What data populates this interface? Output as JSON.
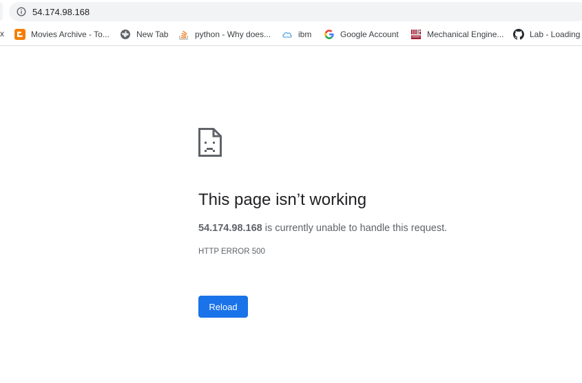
{
  "omnibox": {
    "url": "54.174.98.168",
    "info_icon": "info-circle-icon"
  },
  "bookmarks_bar": {
    "truncated_left": "x",
    "items": [
      {
        "label": "Movies Archive - To...",
        "icon": "blogger-icon",
        "color": "#f57d00"
      },
      {
        "label": "New Tab",
        "icon": "globe-icon",
        "color": "#5f6368"
      },
      {
        "label": "python - Why does...",
        "icon": "stackoverflow-icon",
        "color": "#f48024"
      },
      {
        "label": "ibm",
        "icon": "cloud-icon",
        "color": "#5aa9e6"
      },
      {
        "label": "Google Account",
        "icon": "google-icon",
        "color": "#4285f4"
      },
      {
        "label": "Mechanical Engine...",
        "icon": "mit-ocw-icon",
        "color": "#a31f34"
      },
      {
        "label": "Lab - Loading",
        "icon": "github-icon",
        "color": "#24292e"
      }
    ]
  },
  "error_page": {
    "icon": "sad-page-icon",
    "title": "This page isn’t working",
    "host": "54.174.98.168",
    "message_rest": " is currently unable to handle this request.",
    "error_code": "HTTP ERROR 500",
    "reload_label": "Reload",
    "accent_color": "#1a73e8"
  }
}
